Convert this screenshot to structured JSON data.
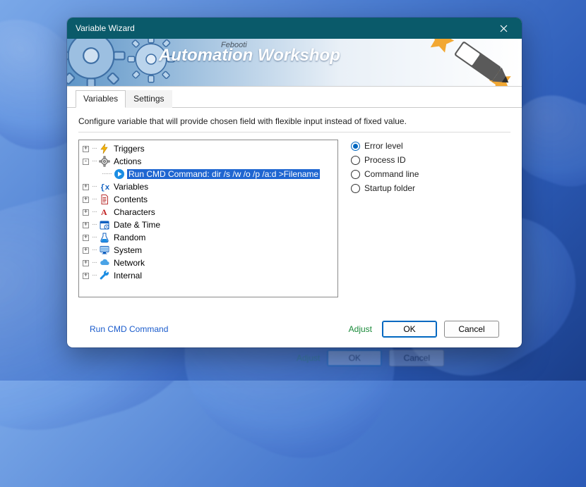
{
  "window": {
    "title": "Variable Wizard"
  },
  "banner": {
    "brand_sub": "Febooti",
    "brand_title": "Automation Workshop"
  },
  "tabs": {
    "variables": "Variables",
    "settings": "Settings"
  },
  "description": "Configure variable that will provide chosen field with flexible input instead of fixed value.",
  "tree": {
    "triggers": "Triggers",
    "actions": "Actions",
    "action_cmd": "Run CMD Command: dir /s /w /o /p /a:d >Filename",
    "variables": "Variables",
    "contents": "Contents",
    "characters": "Characters",
    "datetime": "Date & Time",
    "random": "Random",
    "system": "System",
    "network": "Network",
    "internal": "Internal"
  },
  "options": {
    "error_level": "Error level",
    "process_id": "Process ID",
    "command_line": "Command line",
    "startup_folder": "Startup folder"
  },
  "footer": {
    "link": "Run CMD Command",
    "adjust": "Adjust",
    "ok": "OK",
    "cancel": "Cancel"
  }
}
